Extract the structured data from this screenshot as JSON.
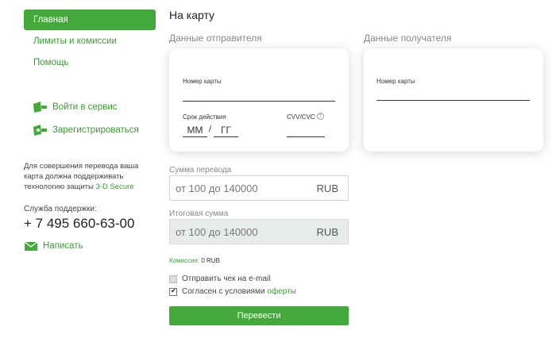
{
  "sidebar": {
    "items": [
      {
        "label": "Главная"
      },
      {
        "label": "Лимиты и комиссии"
      },
      {
        "label": "Помощь"
      }
    ],
    "login": "Войти в сервис",
    "register": "Зарегистрироваться",
    "note_prefix": "Для совершения перевода ваша карта должна поддерживать технологию защиты",
    "note_link": "3-D Secure",
    "support_label": "Служба поддержки:",
    "phone": "+ 7 495 660-63-00",
    "write": "Написать"
  },
  "main": {
    "title": "На карту",
    "sender": {
      "title": "Данные отправителя",
      "card_label": "Номер карты",
      "expiry_label": "Срок действия",
      "month_placeholder": "ММ",
      "slash": "/",
      "year_placeholder": "ГГ",
      "cvv_label": "CVV/CVC",
      "help_glyph": "?"
    },
    "receiver": {
      "title": "Данные получателя",
      "card_label": "Номер карты"
    },
    "amount": {
      "label": "Сумма перевода",
      "placeholder": "от 100 до 140000",
      "currency": "RUB"
    },
    "total": {
      "label": "Итоговая сумма",
      "placeholder": "от 100 до 140000",
      "currency": "RUB"
    },
    "fee": {
      "label": "Комиссия:",
      "value": "0 RUB"
    },
    "email_receipt": {
      "label": "Отправить чек на e-mail",
      "checked": false
    },
    "agree": {
      "label": "Согласен с условиями",
      "link": "оферты",
      "checked": true
    },
    "submit_label": "Перевести"
  },
  "colors": {
    "accent": "#45a83b",
    "link": "#3a9c32"
  }
}
